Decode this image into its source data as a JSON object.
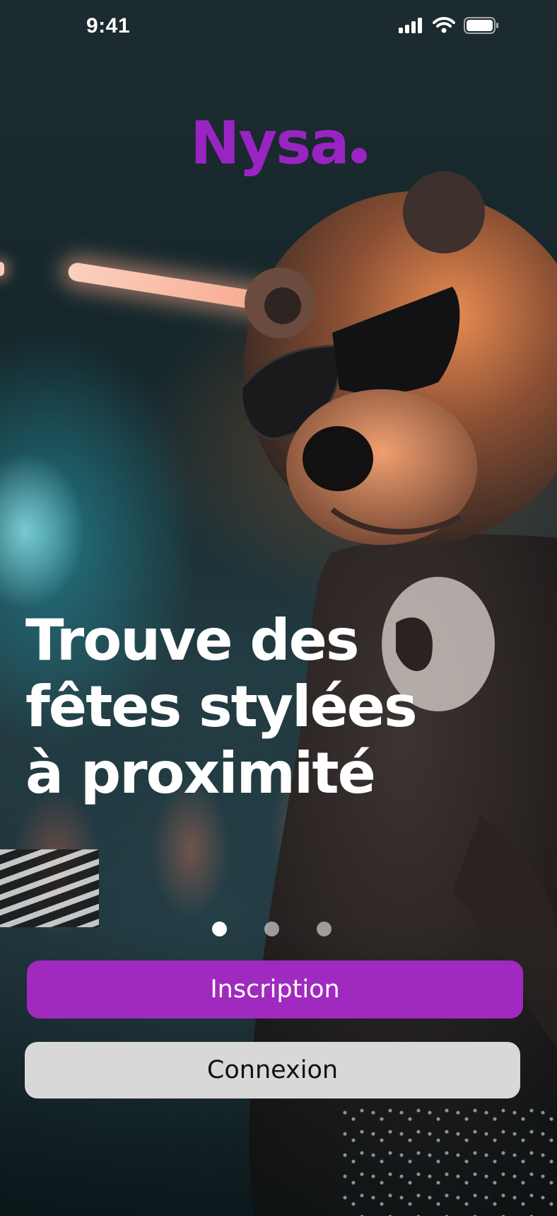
{
  "status_bar": {
    "time": "9:41",
    "icons": [
      "cellular-signal-icon",
      "wifi-icon",
      "battery-icon"
    ]
  },
  "brand": {
    "name": "Nysa",
    "color": "#9a24c3"
  },
  "hero": {
    "headline_lines": [
      "Trouve des",
      "fêtes stylées",
      "à proximité"
    ]
  },
  "pager": {
    "count": 3,
    "active_index": 0
  },
  "actions": {
    "signup_label": "Inscription",
    "login_label": "Connexion",
    "signup_color": "#a02ac0",
    "login_color": "#d8d8d8"
  }
}
